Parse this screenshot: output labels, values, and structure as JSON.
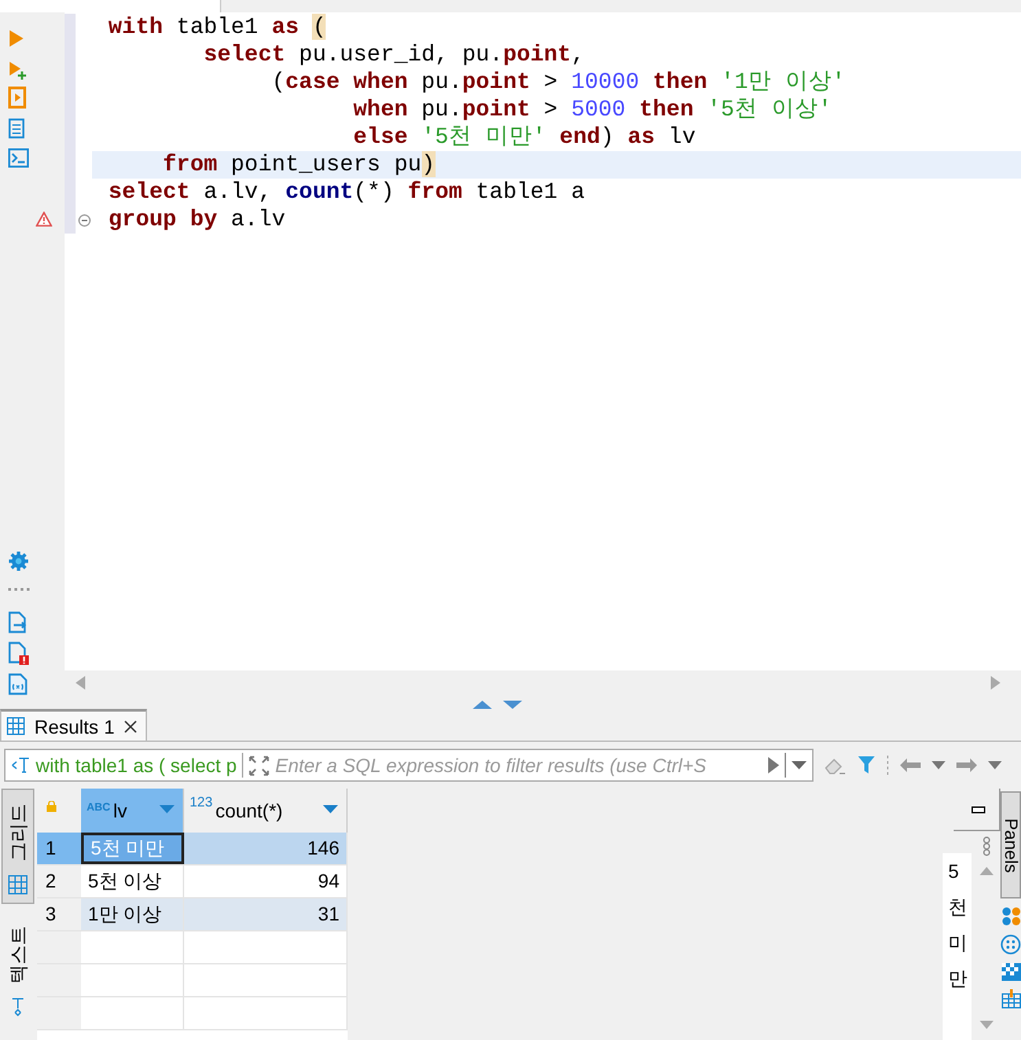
{
  "editor": {
    "lines": [
      {
        "current": false,
        "warning": false,
        "fold": false,
        "tokens": [
          {
            "kind": "kw",
            "text": "with"
          },
          {
            "kind": "plain",
            "text": " table1 "
          },
          {
            "kind": "kw",
            "text": "as "
          },
          {
            "kind": "bracket",
            "text": "("
          }
        ]
      },
      {
        "current": false,
        "warning": false,
        "fold": false,
        "tokens": [
          {
            "kind": "kw",
            "text": "       select"
          },
          {
            "kind": "plain",
            "text": " pu.user_id, pu."
          },
          {
            "kind": "kw",
            "text": "point"
          },
          {
            "kind": "plain",
            "text": ","
          }
        ]
      },
      {
        "current": false,
        "warning": false,
        "fold": false,
        "tokens": [
          {
            "kind": "plain",
            "text": "            ("
          },
          {
            "kind": "kw",
            "text": "case when"
          },
          {
            "kind": "plain",
            "text": " pu."
          },
          {
            "kind": "kw",
            "text": "point"
          },
          {
            "kind": "plain",
            "text": " > "
          },
          {
            "kind": "num",
            "text": "10000 "
          },
          {
            "kind": "kw",
            "text": "then "
          },
          {
            "kind": "str",
            "text": "'1만 이상'"
          }
        ]
      },
      {
        "current": false,
        "warning": false,
        "fold": false,
        "tokens": [
          {
            "kind": "kw",
            "text": "                  when"
          },
          {
            "kind": "plain",
            "text": " pu."
          },
          {
            "kind": "kw",
            "text": "point"
          },
          {
            "kind": "plain",
            "text": " > "
          },
          {
            "kind": "num",
            "text": "5000 "
          },
          {
            "kind": "kw",
            "text": "then "
          },
          {
            "kind": "str",
            "text": "'5천 이상'"
          }
        ]
      },
      {
        "current": false,
        "warning": false,
        "fold": false,
        "tokens": [
          {
            "kind": "kw",
            "text": "                  else "
          },
          {
            "kind": "str",
            "text": "'5천 미만' "
          },
          {
            "kind": "kw",
            "text": "end"
          },
          {
            "kind": "plain",
            "text": ") "
          },
          {
            "kind": "kw",
            "text": "as"
          },
          {
            "kind": "plain",
            "text": " lv"
          }
        ]
      },
      {
        "current": true,
        "warning": false,
        "fold": false,
        "tokens": [
          {
            "kind": "kw",
            "text": "    from"
          },
          {
            "kind": "plain",
            "text": " point_users pu"
          },
          {
            "kind": "bracket",
            "text": ")"
          }
        ]
      },
      {
        "current": false,
        "warning": false,
        "fold": false,
        "tokens": [
          {
            "kind": "kw",
            "text": "select"
          },
          {
            "kind": "plain",
            "text": " a.lv, "
          },
          {
            "kind": "func",
            "text": "count"
          },
          {
            "kind": "plain",
            "text": "(*) "
          },
          {
            "kind": "kw",
            "text": "from"
          },
          {
            "kind": "plain",
            "text": " table1 a"
          }
        ]
      },
      {
        "current": false,
        "warning": true,
        "fold": true,
        "tokens": [
          {
            "kind": "kw",
            "text": "group by"
          },
          {
            "kind": "plain",
            "text": " a.lv"
          }
        ]
      }
    ]
  },
  "results": {
    "tabs": [
      {
        "label": "Results 1",
        "selected": true
      }
    ],
    "query_preview": "with table1 as ( select p",
    "filter": {
      "placeholder": "Enter a SQL expression to filter results (use Ctrl+S"
    },
    "side_tabs": [
      {
        "label": "그리드",
        "selected": true
      },
      {
        "label": "텍스트",
        "selected": false
      }
    ],
    "columns": [
      {
        "type": "ABC",
        "kind": "text",
        "label": "lv",
        "selected": true
      },
      {
        "type": "123",
        "kind": "number",
        "label": "count(*)",
        "selected": false
      }
    ],
    "rows": [
      {
        "num": "1",
        "selected": true,
        "cells": [
          "5천 미만",
          "146"
        ]
      },
      {
        "num": "2",
        "selected": false,
        "cells": [
          "5천 이상",
          "94"
        ]
      },
      {
        "num": "3",
        "selected": false,
        "cells": [
          "1만 이상",
          "31"
        ]
      }
    ],
    "value_panel": {
      "text": "5천미만"
    },
    "panels_tab": "Panels"
  }
}
